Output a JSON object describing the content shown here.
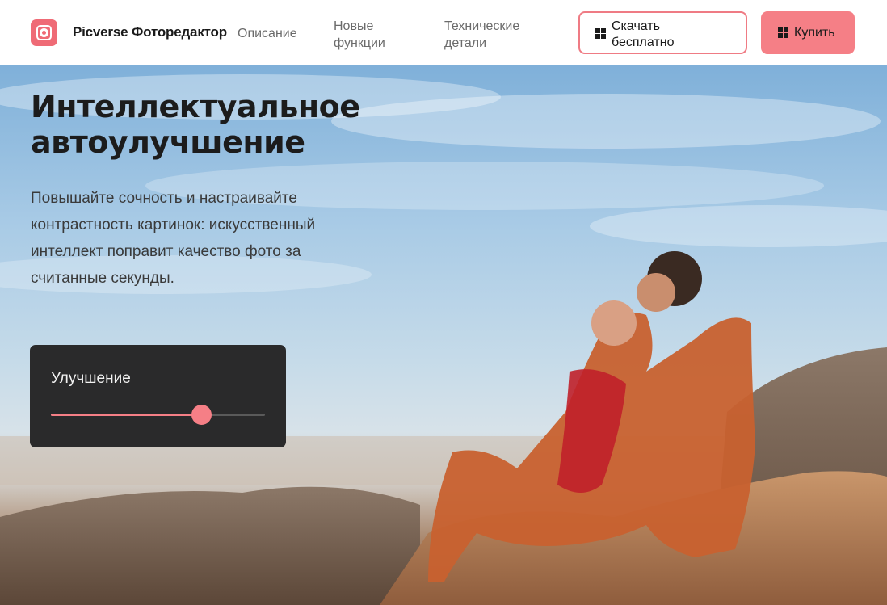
{
  "header": {
    "brand": "Picverse Фоторедактор",
    "nav": {
      "description": "Описание",
      "new_line1": "Новые",
      "new_line2": "функции",
      "tech_line1": "Технические",
      "tech_line2": "детали"
    },
    "download_line1": "Скачать",
    "download_line2": "бесплатно",
    "buy_label": "Купить",
    "icons": {
      "logo": "photo-frame-icon",
      "windows": "windows-icon"
    }
  },
  "hero": {
    "title_line1": "Интеллектуальное",
    "title_line2": "автоулучшение",
    "text_line1": "Повышайте сочность и настраивайте",
    "text_line2": "контрастность картинок: искусственный",
    "text_line3": "интеллект поправит качество фото за",
    "text_line4": "считанные секунды."
  },
  "enhance": {
    "label": "Улучшение",
    "value_fraction": 0.7
  },
  "colors": {
    "accent": "#f57f86",
    "panel": "#2a2a2b",
    "logo": "#ef6b76"
  }
}
